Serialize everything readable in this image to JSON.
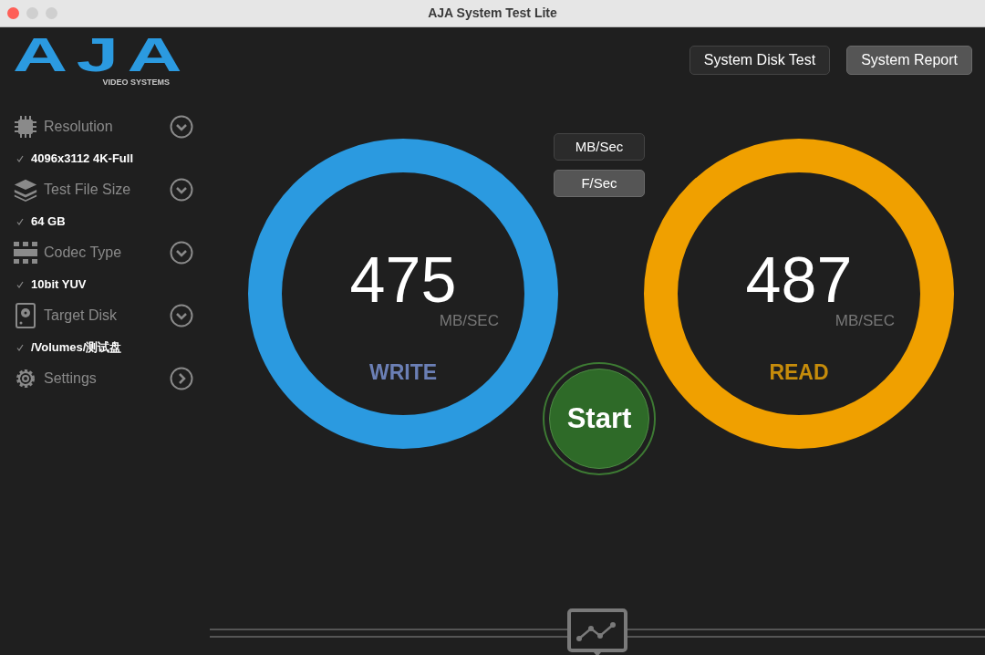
{
  "window": {
    "title": "AJA System Test Lite"
  },
  "logo": {
    "text": "AJA",
    "subtitle": "VIDEO SYSTEMS"
  },
  "header_buttons": [
    {
      "label": "System Disk Test",
      "selected": false
    },
    {
      "label": "System Report",
      "selected": true
    }
  ],
  "sidebar": {
    "items": [
      {
        "kind": "resolution",
        "label": "Resolution",
        "value": "4096x3112 4K-Full",
        "dropdown": true
      },
      {
        "kind": "file_size",
        "label": "Test File Size",
        "value": "64 GB",
        "dropdown": true
      },
      {
        "kind": "codec",
        "label": "Codec Type",
        "value": "10bit YUV",
        "dropdown": true
      },
      {
        "kind": "disk",
        "label": "Target Disk",
        "value": "/Volumes/测试盘",
        "dropdown": true
      },
      {
        "kind": "settings",
        "label": "Settings",
        "dropdown": false
      }
    ]
  },
  "units": [
    {
      "label": "MB/Sec",
      "selected": false
    },
    {
      "label": "F/Sec",
      "selected": true
    }
  ],
  "gauges": [
    {
      "kind": "write",
      "value": "475",
      "unit": "MB/SEC",
      "label": "WRITE",
      "color": "#2b9ae0"
    },
    {
      "kind": "read",
      "value": "487",
      "unit": "MB/SEC",
      "label": "READ",
      "color": "#f0a000"
    }
  ],
  "start_button": {
    "label": "Start"
  }
}
